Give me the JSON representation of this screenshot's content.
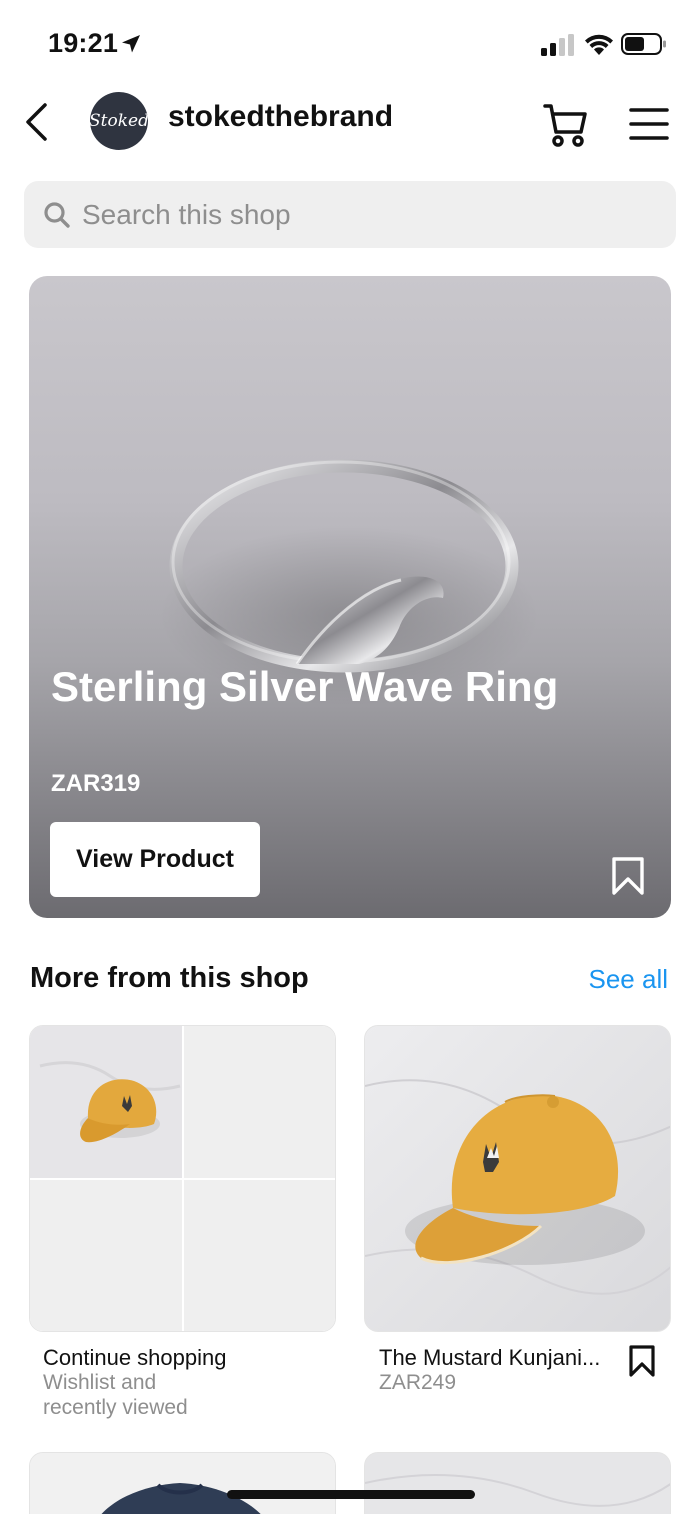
{
  "status_bar": {
    "time": "19:21",
    "icons": [
      "location-arrow-icon",
      "signal-icon",
      "wifi-icon",
      "battery-icon"
    ]
  },
  "header": {
    "back_icon": "chevron-left-icon",
    "avatar_text": "Stoked",
    "shop_name": "stokedthebrand",
    "cart_icon": "cart-icon",
    "menu_icon": "hamburger-menu-icon"
  },
  "search": {
    "placeholder": "Search this shop",
    "icon": "search-icon"
  },
  "hero": {
    "title": "Sterling Silver Wave Ring",
    "price": "ZAR319",
    "button_label": "View Product",
    "save_icon": "bookmark-icon"
  },
  "more_section": {
    "title": "More from this shop",
    "see_all": "See all",
    "cards": [
      {
        "title": "Continue shopping",
        "subtitle_line1": "Wishlist and",
        "subtitle_line2": "recently viewed"
      },
      {
        "title": "The Mustard Kunjani...",
        "price": "ZAR249",
        "save_icon": "bookmark-icon"
      }
    ]
  },
  "colors": {
    "accent": "#1a95f0",
    "search_bg": "#efefef",
    "cap_mustard": "#e3a83d"
  }
}
